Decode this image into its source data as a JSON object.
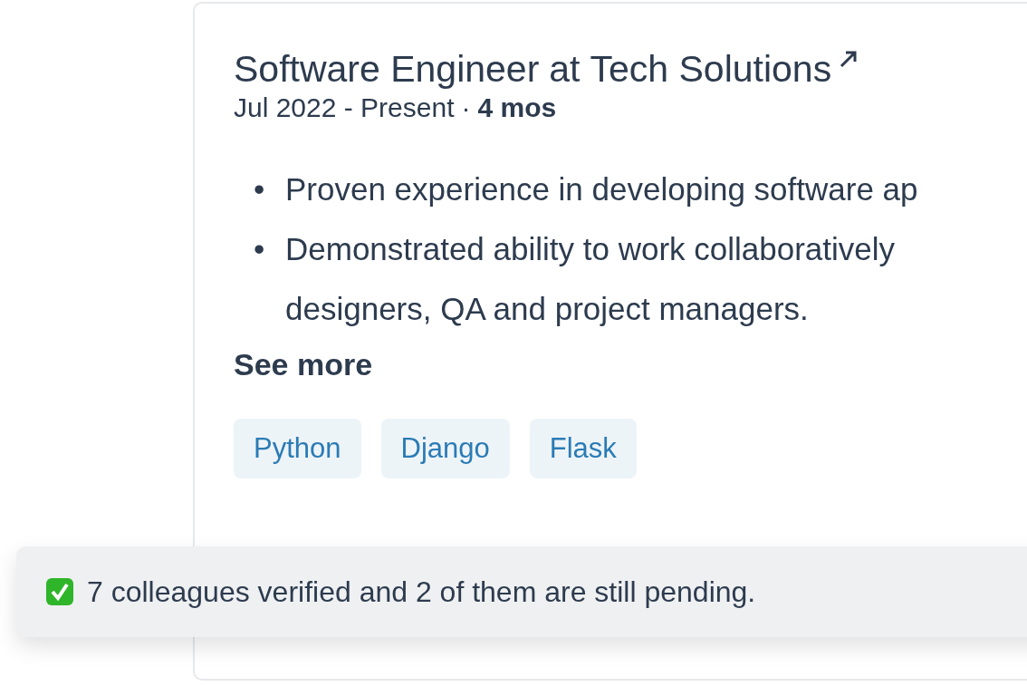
{
  "experience": {
    "role": "Software Engineer",
    "connector": "at",
    "company": "Tech Solutions",
    "dates": "Jul 2022 - Present",
    "separator": "·",
    "duration": "4 mos",
    "bullets": [
      {
        "marker": "•",
        "lines": [
          "Proven experience in developing software ap"
        ]
      },
      {
        "marker": "•",
        "lines": [
          "Demonstrated ability to work collaboratively",
          "designers, QA and project managers."
        ]
      }
    ],
    "see_more": "See more",
    "skills": [
      "Python",
      "Django",
      "Flask"
    ]
  },
  "toast": {
    "message": "7 colleagues verified and 2 of them are still pending."
  }
}
